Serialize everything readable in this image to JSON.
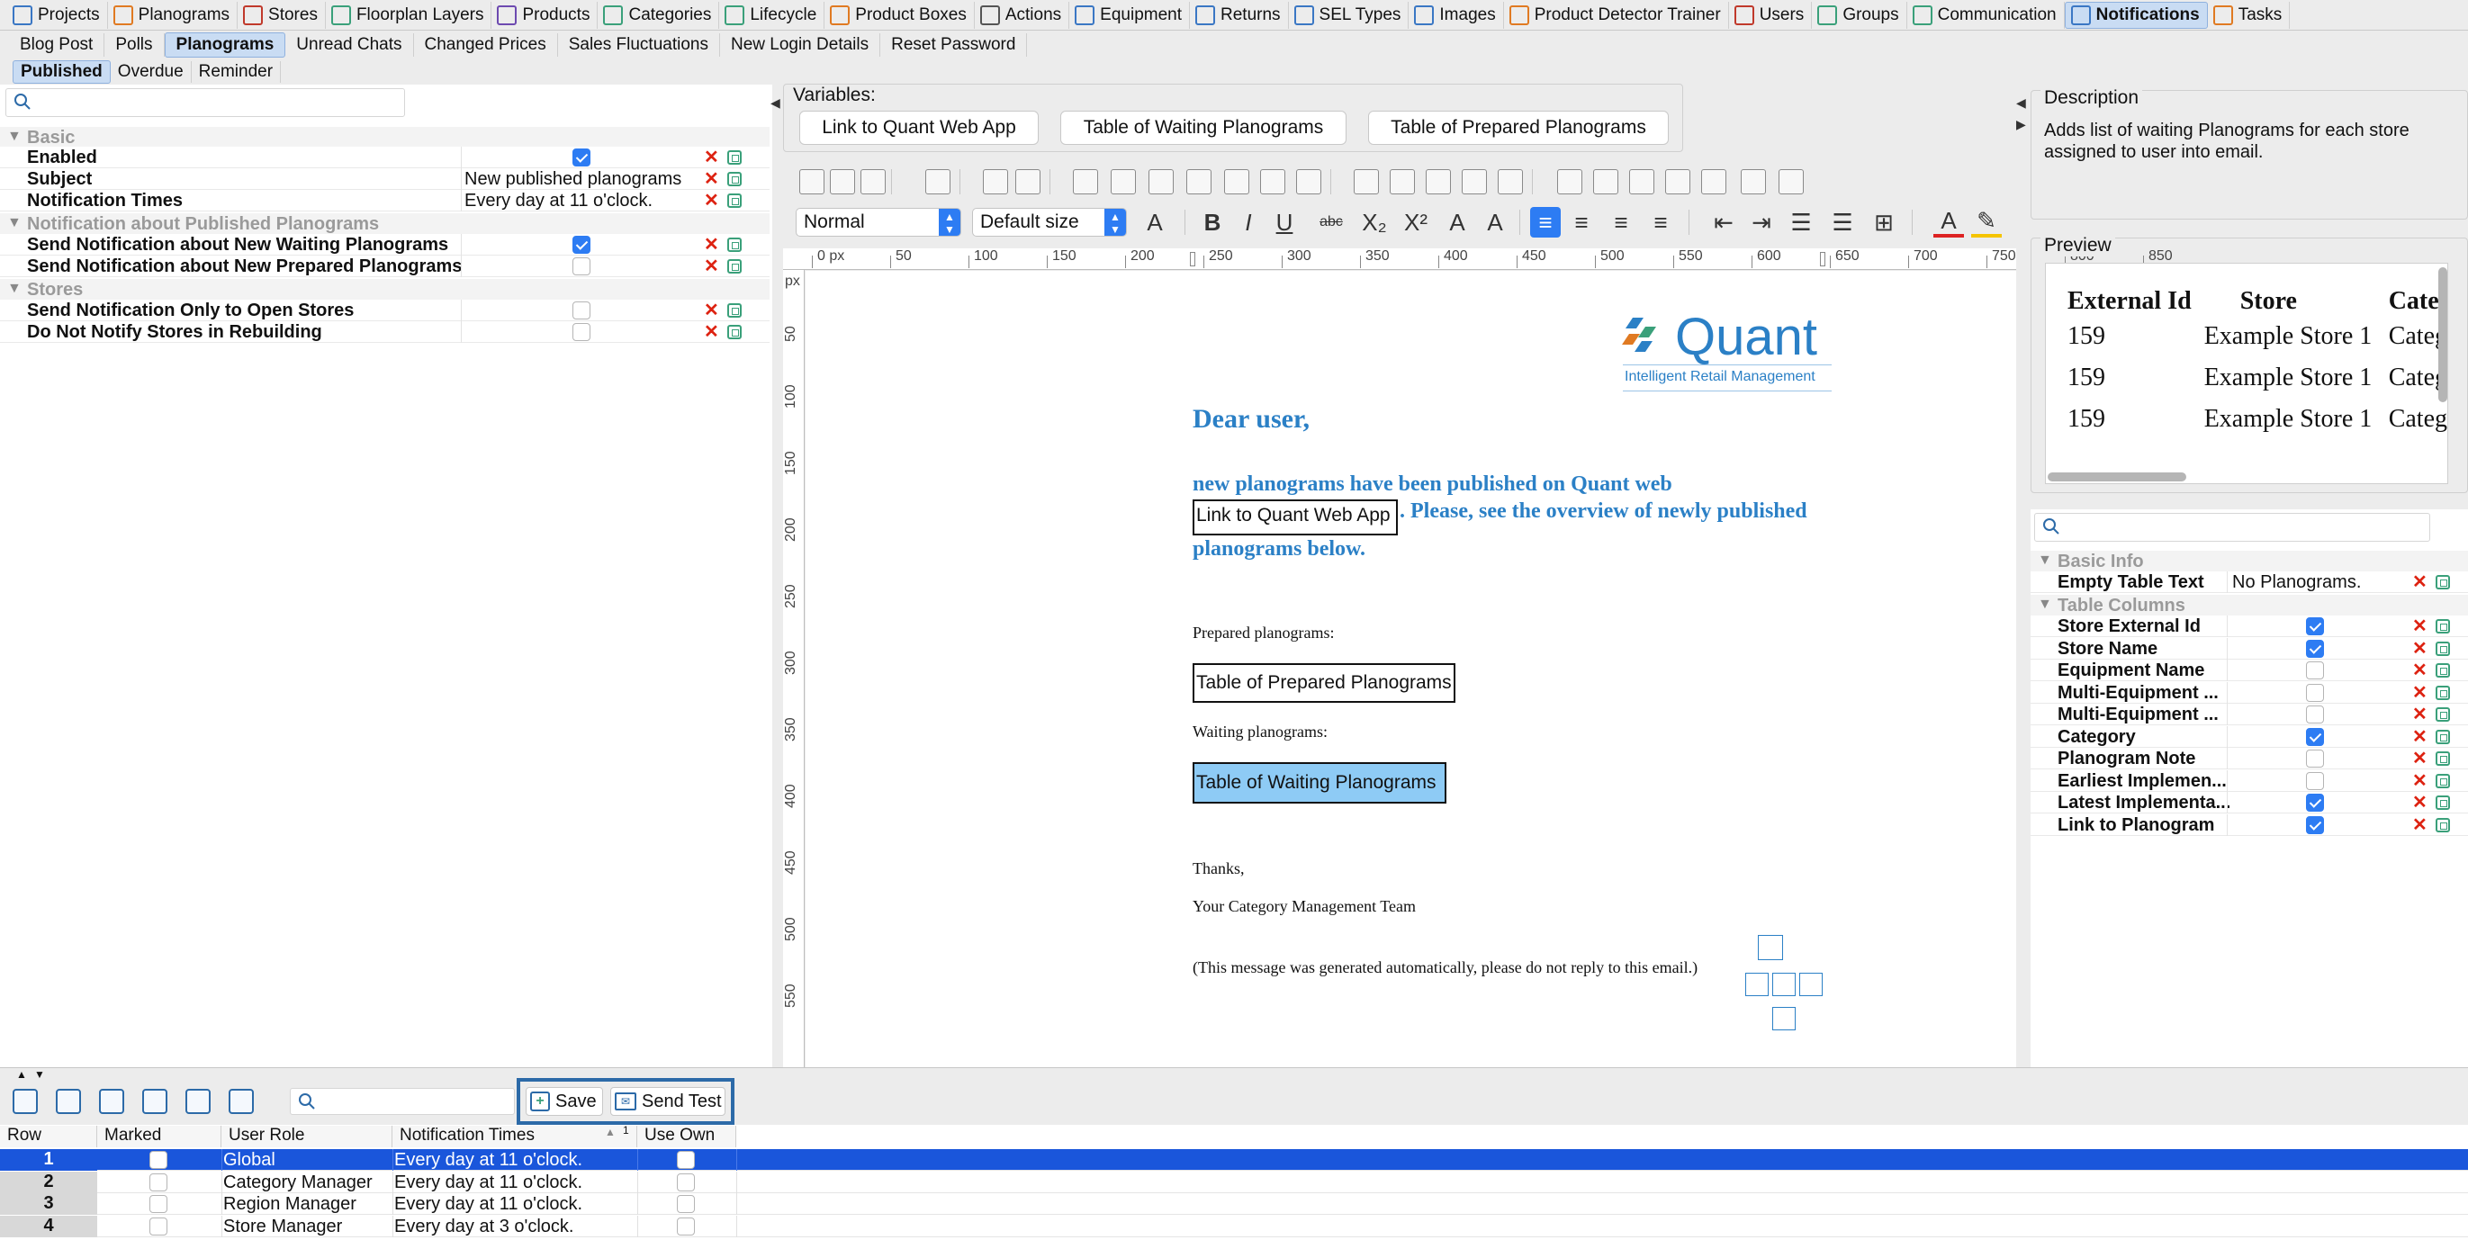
{
  "tabs": [
    {
      "label": "Projects",
      "icon": "projects-icon",
      "color": "#3a77c4"
    },
    {
      "label": "Planograms",
      "icon": "planograms-icon",
      "color": "#e07a22"
    },
    {
      "label": "Stores",
      "icon": "stores-icon",
      "color": "#c0392b"
    },
    {
      "label": "Floorplan Layers",
      "icon": "floorplan-icon",
      "color": "#3aa07a"
    },
    {
      "label": "Products",
      "icon": "products-icon",
      "color": "#6d4ab0"
    },
    {
      "label": "Categories",
      "icon": "categories-icon",
      "color": "#3aa07a"
    },
    {
      "label": "Lifecycle",
      "icon": "lifecycle-icon",
      "color": "#3aa07a"
    },
    {
      "label": "Product Boxes",
      "icon": "boxes-icon",
      "color": "#e07a22"
    },
    {
      "label": "Actions",
      "icon": "actions-icon",
      "color": "#555555"
    },
    {
      "label": "Equipment",
      "icon": "equipment-icon",
      "color": "#3a77c4"
    },
    {
      "label": "Returns",
      "icon": "returns-icon",
      "color": "#3a77c4"
    },
    {
      "label": "SEL Types",
      "icon": "sel-icon",
      "color": "#3a77c4"
    },
    {
      "label": "Images",
      "icon": "images-icon",
      "color": "#3a77c4"
    },
    {
      "label": "Product Detector Trainer",
      "icon": "trainer-icon",
      "color": "#e07a22"
    },
    {
      "label": "Users",
      "icon": "users-icon",
      "color": "#c0392b"
    },
    {
      "label": "Groups",
      "icon": "groups-icon",
      "color": "#3aa07a"
    },
    {
      "label": "Communication",
      "icon": "communication-icon",
      "color": "#3aa07a"
    },
    {
      "label": "Notifications",
      "icon": "notifications-icon",
      "color": "#3a77c4",
      "active": true
    },
    {
      "label": "Tasks",
      "icon": "tasks-icon",
      "color": "#e07a22"
    }
  ],
  "subtabs": [
    "Blog Post",
    "Polls",
    "Planograms",
    "Unread Chats",
    "Changed Prices",
    "Sales Fluctuations",
    "New Login Details",
    "Reset Password"
  ],
  "subtabs_active": "Planograms",
  "subsubtabs": [
    "Published",
    "Overdue",
    "Reminder"
  ],
  "subsubtabs_active": "Published",
  "left_panel": {
    "groups": [
      {
        "label": "Basic"
      },
      {
        "label": "Notification about Published Planograms"
      },
      {
        "label": "Stores"
      }
    ],
    "rows": {
      "enabled": {
        "label": "Enabled",
        "checked": true
      },
      "subject": {
        "label": "Subject",
        "value": "New published planograms"
      },
      "notification_times": {
        "label": "Notification Times",
        "value": "Every day at 11 o'clock."
      },
      "send_waiting": {
        "label": "Send Notification about New Waiting Planograms",
        "checked": true
      },
      "send_prepared": {
        "label": "Send Notification about New Prepared Planograms",
        "checked": false
      },
      "open_stores": {
        "label": "Send Notification Only to Open Stores",
        "checked": false
      },
      "rebuilding": {
        "label": "Do Not Notify Stores in Rebuilding",
        "checked": false
      }
    }
  },
  "variables": {
    "title": "Variables:",
    "buttons": [
      "Link to Quant Web App",
      "Table of Waiting Planograms",
      "Table of Prepared Planograms"
    ]
  },
  "format": {
    "style": "Normal",
    "size": "Default size"
  },
  "ruler": {
    "top_labels": [
      "0 px",
      "50",
      "100",
      "150",
      "200",
      "250",
      "300",
      "350",
      "400",
      "450",
      "500",
      "550",
      "600",
      "650",
      "700",
      "750",
      "800",
      "850"
    ],
    "left_unit": "px",
    "left_labels": [
      "50",
      "100",
      "150",
      "200",
      "250",
      "300",
      "350",
      "400",
      "450",
      "500",
      "550"
    ]
  },
  "email": {
    "logo_name": "Quant",
    "logo_tagline": "Intelligent Retail Management",
    "greeting": "Dear user,",
    "line1": "new planograms have been published on Quant web",
    "link_var": "Link to Quant Web App",
    "line2": ". Please, see the overview of newly published",
    "line3": "planograms below.",
    "prepared_label": "Prepared planograms:",
    "prepared_var": "Table of Prepared Planograms",
    "waiting_label": "Waiting planograms:",
    "waiting_var": "Table of Waiting Planograms",
    "thanks": "Thanks,",
    "signature": "Your Category Management Team",
    "footer": "(This message was generated automatically, please do not reply to this email.)"
  },
  "description": {
    "title": "Description",
    "text_line1": "Adds list of waiting Planograms for each store",
    "text_line2": "assigned to user into email."
  },
  "preview": {
    "title": "Preview",
    "headers": [
      "External Id",
      "Store",
      "Cate"
    ],
    "rows": [
      [
        "159",
        "Example Store 1",
        "Categ"
      ],
      [
        "159",
        "Example Store 1",
        "Categ"
      ],
      [
        "159",
        "Example Store 1",
        "Categ"
      ]
    ]
  },
  "right_panel": {
    "groups": [
      {
        "label": "Basic Info"
      },
      {
        "label": "Table Columns"
      }
    ],
    "empty_text": {
      "label": "Empty Table Text",
      "value": "No Planograms."
    },
    "columns": [
      {
        "label": "Store External Id",
        "checked": true
      },
      {
        "label": "Store Name",
        "checked": true
      },
      {
        "label": "Equipment Name",
        "checked": false
      },
      {
        "label": "Multi-Equipment ...",
        "checked": false
      },
      {
        "label": "Multi-Equipment ...",
        "checked": false
      },
      {
        "label": "Category",
        "checked": true
      },
      {
        "label": "Planogram Note",
        "checked": false
      },
      {
        "label": "Earliest Implemen...",
        "checked": false
      },
      {
        "label": "Latest Implementa...",
        "checked": true
      },
      {
        "label": "Link to Planogram",
        "checked": true
      }
    ]
  },
  "bottom": {
    "save_label": "Save",
    "send_test_label": "Send Test",
    "headers": [
      "Row",
      "Marked",
      "User Role",
      "Notification Times",
      "Use Own"
    ],
    "sort_indicator": "1",
    "rows": [
      {
        "row": "1",
        "role": "Global",
        "times": "Every day at 11 o'clock.",
        "selected": true
      },
      {
        "row": "2",
        "role": "Category Manager",
        "times": "Every day at 11 o'clock.",
        "selected": false
      },
      {
        "row": "3",
        "role": "Region Manager",
        "times": "Every day at 11 o'clock.",
        "selected": false
      },
      {
        "row": "4",
        "role": "Store Manager",
        "times": "Every day at 3 o'clock.",
        "selected": false
      }
    ]
  },
  "colors": {
    "accent": "#2d7cf3",
    "selection": "#1a56db",
    "email_blue": "#2b80c6",
    "highlight_var": "#8ecbf5",
    "delete_red": "#d22222"
  }
}
